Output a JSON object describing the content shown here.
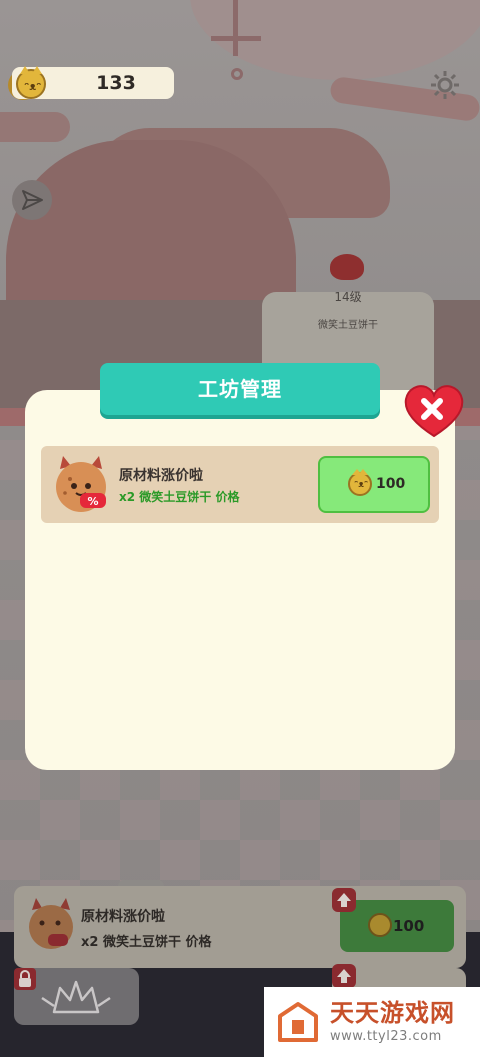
{
  "coin_counter": {
    "value": "133",
    "icon": "cat-coin-icon"
  },
  "background": {
    "level_label": "14级",
    "product_name": "微笑土豆饼干"
  },
  "modal": {
    "title": "工坊管理",
    "close_icon": "close-heart-icon",
    "items": [
      {
        "title": "原材料涨价啦",
        "description": "x2 微笑土豆饼干 价格",
        "price": "100",
        "icon": "devil-cookie-icon"
      }
    ]
  },
  "bottom_hud": {
    "upgrade_card": {
      "title": "原材料涨价啦",
      "description": "x2 微笑土豆饼干 价格",
      "price": "100"
    }
  },
  "watermark": {
    "title": "天天游戏网",
    "url": "www.ttyl23.com"
  },
  "colors": {
    "modal_header": "#2fcab5",
    "modal_body": "#fdfae6",
    "buy_button": "#86e97a",
    "close_heart": "#e5283a",
    "desc_green": "#2b9a28"
  }
}
